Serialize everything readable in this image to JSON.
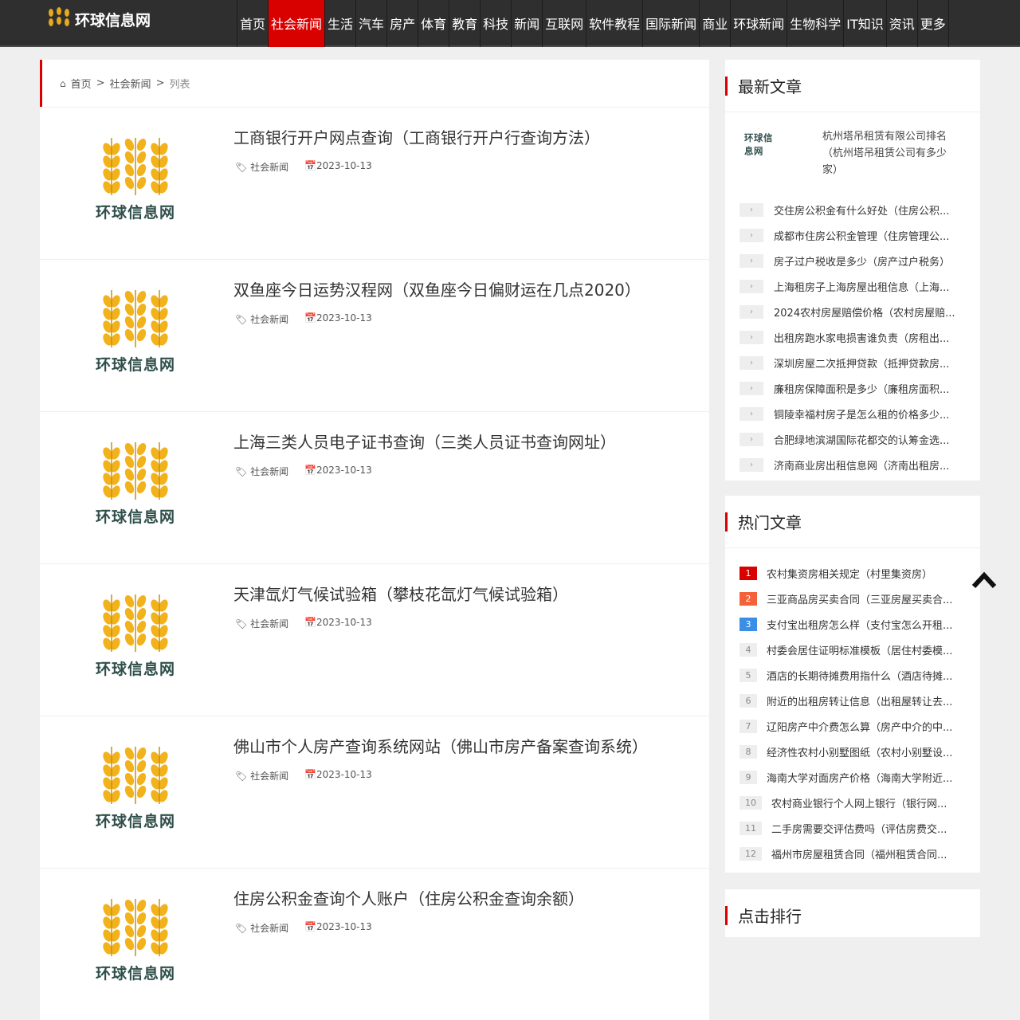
{
  "site": {
    "name": "环球信息网",
    "logo_text": "环球信息网"
  },
  "nav": {
    "items": [
      "首页",
      "社会新闻",
      "生活",
      "汽车",
      "房产",
      "体育",
      "教育",
      "科技",
      "新闻",
      "互联网",
      "软件教程",
      "国际新闻",
      "商业",
      "环球新闻",
      "生物科学",
      "IT知识",
      "资讯",
      "更多"
    ],
    "active": 1
  },
  "breadcrumb": {
    "home": "首页",
    "sep": ">",
    "category": "社会新闻",
    "current": "列表"
  },
  "articles": [
    {
      "title": "工商银行开户网点查询（工商银行开户行查询方法）",
      "category": "社会新闻",
      "date": "2023-10-13"
    },
    {
      "title": "双鱼座今日运势汉程网（双鱼座今日偏财运在几点2020）",
      "category": "社会新闻",
      "date": "2023-10-13"
    },
    {
      "title": "上海三类人员电子证书查询（三类人员证书查询网址）",
      "category": "社会新闻",
      "date": "2023-10-13"
    },
    {
      "title": "天津氙灯气候试验箱（攀枝花氙灯气候试验箱）",
      "category": "社会新闻",
      "date": "2023-10-13"
    },
    {
      "title": "佛山市个人房产查询系统网站（佛山市房产备案查询系统）",
      "category": "社会新闻",
      "date": "2023-10-13"
    },
    {
      "title": "住房公积金查询个人账户（住房公积金查询余额）",
      "category": "社会新闻",
      "date": "2023-10-13"
    }
  ],
  "latest": {
    "title": "最新文章",
    "featured": "杭州塔吊租赁有限公司排名（杭州塔吊租赁公司有多少家）",
    "items": [
      "交住房公积金有什么好处（住房公积...",
      "成都市住房公积金管理（住房管理公...",
      "房子过户税收是多少（房产过户税务）",
      "上海租房子上海房屋出租信息（上海...",
      "2024农村房屋赔偿价格（农村房屋赔...",
      "出租房跑水家电损害谁负责（房租出...",
      "深圳房屋二次抵押贷款（抵押贷款房...",
      "廉租房保障面积是多少（廉租房面积...",
      "铜陵幸福村房子是怎么租的价格多少...",
      "合肥绿地滨湖国际花都交的认筹金选...",
      "济南商业房出租信息网（济南出租房..."
    ]
  },
  "hot": {
    "title": "热门文章",
    "items": [
      "农村集资房相关规定（村里集资房）",
      "三亚商品房买卖合同（三亚房屋买卖合...",
      "支付宝出租房怎么样（支付宝怎么开租...",
      "村委会居住证明标准模板（居住村委模...",
      "酒店的长期待摊费用指什么（酒店待摊...",
      "附近的出租房转让信息（出租屋转让去...",
      "辽阳房产中介费怎么算（房产中介的中...",
      "经济性农村小别墅图纸（农村小别墅设...",
      "海南大学对面房产价格（海南大学附近...",
      "农村商业银行个人网上银行（银行网...",
      "二手房需要交评估费吗（评估房费交...",
      "福州市房屋租赁合同（福州租赁合同..."
    ],
    "rank_colors": [
      "#d90000",
      "#f4623a",
      "#3a8ee6"
    ]
  },
  "rank": {
    "title": "点击排行"
  }
}
